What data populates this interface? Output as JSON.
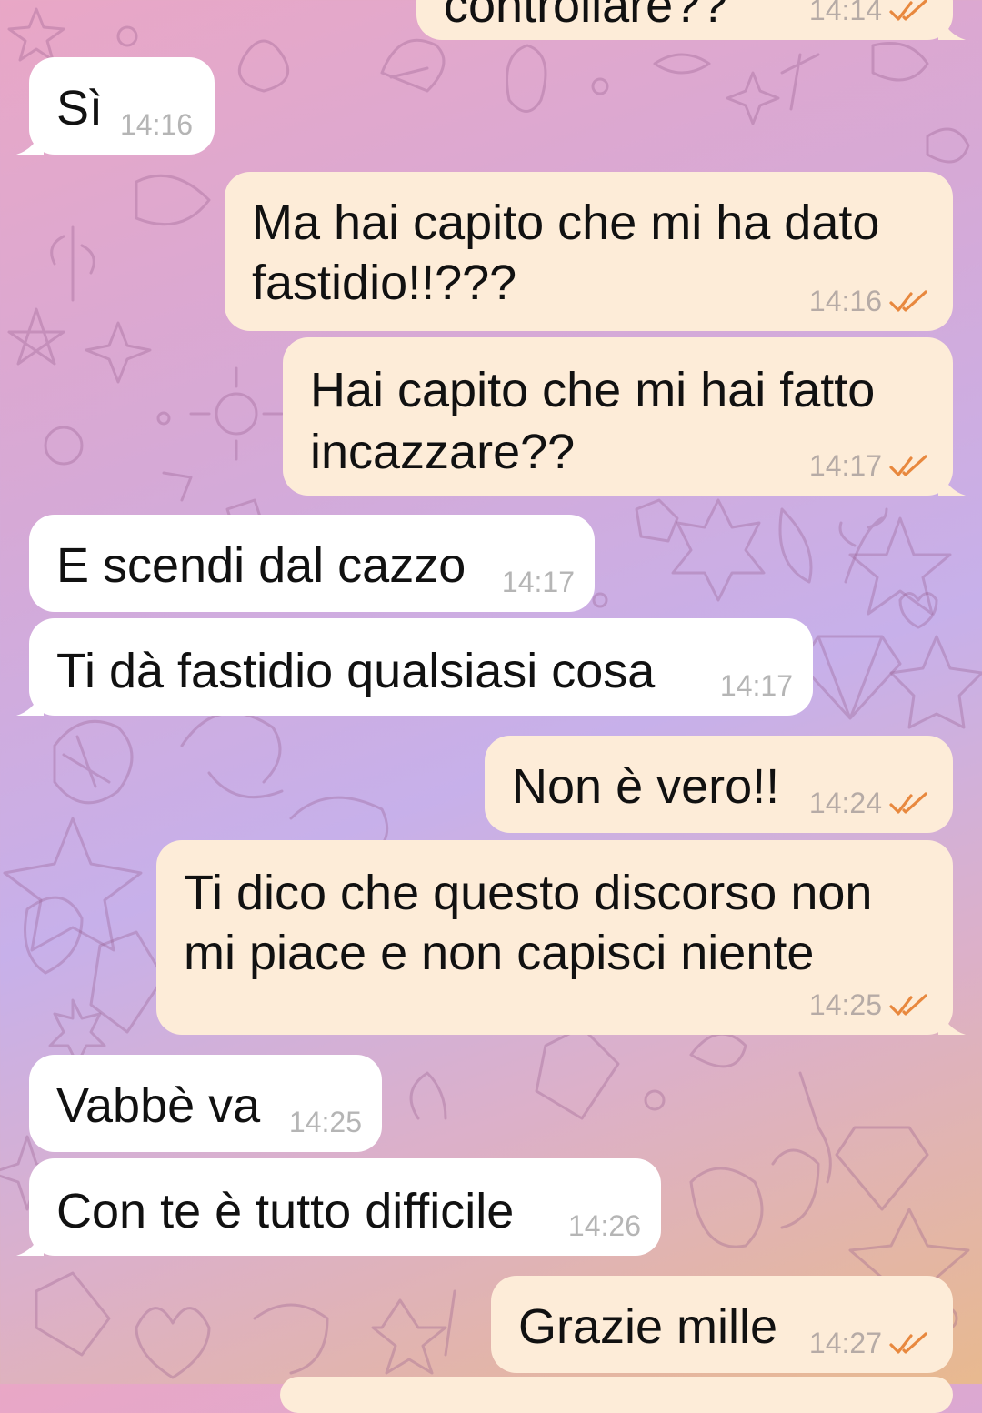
{
  "chat": {
    "messages": [
      {
        "direction": "out",
        "text": "controllare??",
        "time": "14:14",
        "status": "read-double-check"
      },
      {
        "direction": "in",
        "text": "Sì",
        "time": "14:16"
      },
      {
        "direction": "out",
        "text": "Ma hai capito che mi ha dato",
        "text2": "fastidio!!???",
        "time": "14:16",
        "status": "read-double-check"
      },
      {
        "direction": "out",
        "text": "Hai capito che mi hai fatto",
        "text2": "incazzare??",
        "time": "14:17",
        "status": "read-double-check"
      },
      {
        "direction": "in",
        "text": "E scendi dal cazzo",
        "time": "14:17"
      },
      {
        "direction": "in",
        "text": "Ti dà fastidio qualsiasi cosa",
        "time": "14:17"
      },
      {
        "direction": "out",
        "text": "Non è vero!!",
        "time": "14:24",
        "status": "read-double-check"
      },
      {
        "direction": "out",
        "text": "Ti dico che questo discorso non",
        "text2": "mi piace e non capisci niente",
        "time": "14:25",
        "status": "read-double-check"
      },
      {
        "direction": "in",
        "text": "Vabbè va",
        "time": "14:25"
      },
      {
        "direction": "in",
        "text": "Con te è tutto difficile",
        "time": "14:26"
      },
      {
        "direction": "out",
        "text": "Grazie mille",
        "time": "14:27",
        "status": "read-double-check"
      }
    ]
  },
  "colors": {
    "incoming_bubble": "#ffffff",
    "outgoing_bubble": "#fdecd8",
    "read_check": "#e8883e",
    "background_gradient": [
      "#e9a7c6",
      "#c7b0ea",
      "#e8b98f"
    ]
  },
  "icons": {
    "read_status": "double-check-icon"
  }
}
